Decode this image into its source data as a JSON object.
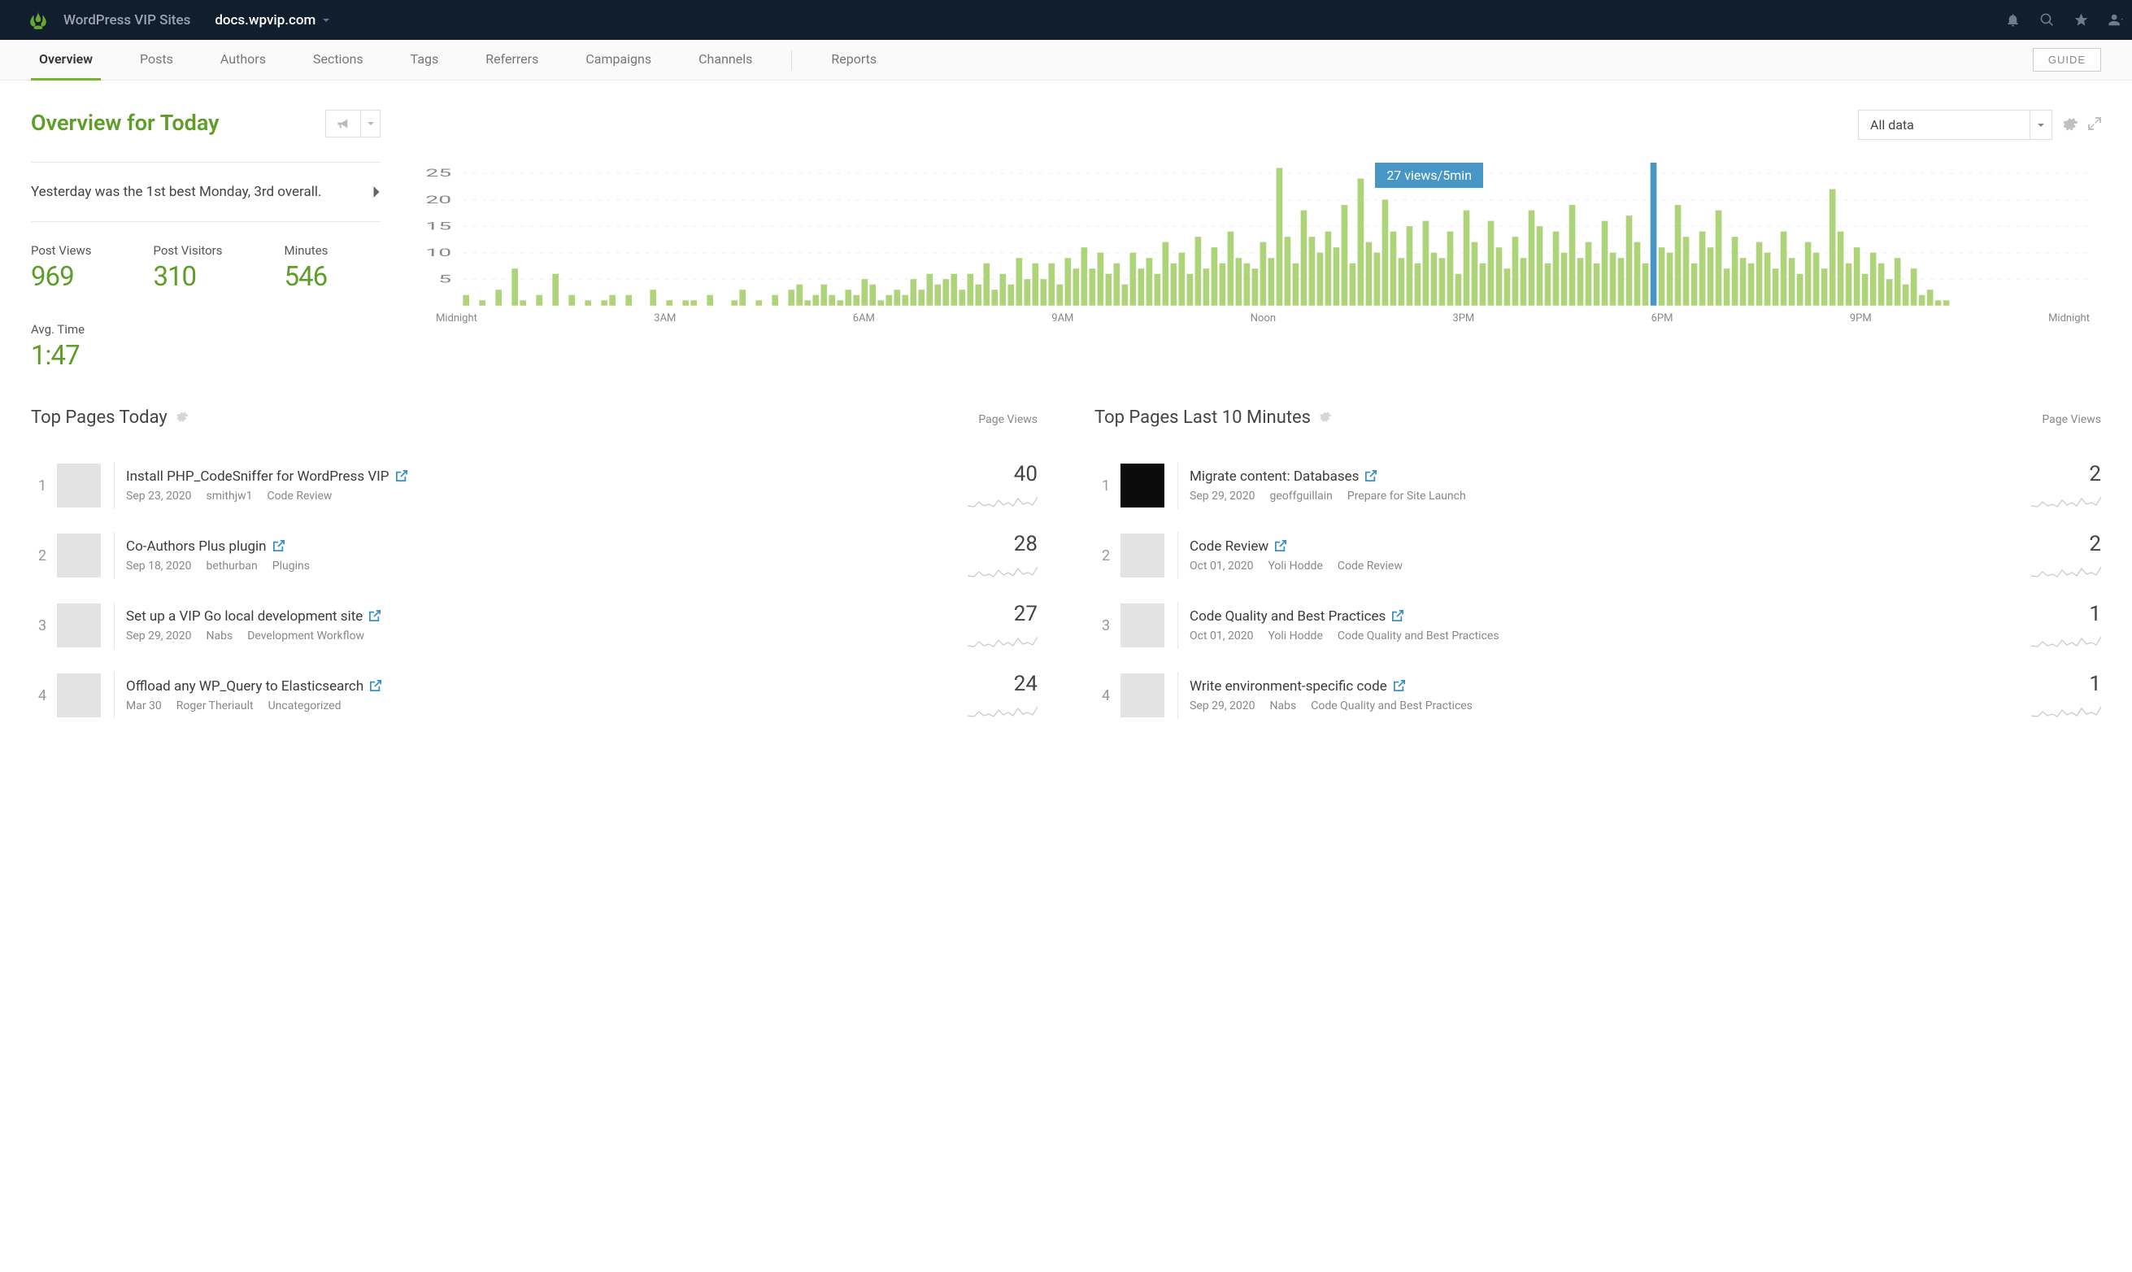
{
  "topbar": {
    "org": "WordPress VIP Sites",
    "site": "docs.wpvip.com"
  },
  "nav": {
    "tabs": [
      "Overview",
      "Posts",
      "Authors",
      "Sections",
      "Tags",
      "Referrers",
      "Campaigns",
      "Channels"
    ],
    "reports": "Reports",
    "guide": "GUIDE"
  },
  "overview": {
    "title": "Overview for Today",
    "insight": "Yesterday was the 1st best Monday, 3rd overall.",
    "metrics": [
      {
        "label": "Post Views",
        "value": "969"
      },
      {
        "label": "Post Visitors",
        "value": "310"
      },
      {
        "label": "Minutes",
        "value": "546"
      },
      {
        "label": "Avg. Time",
        "value": "1:47"
      }
    ]
  },
  "chart_controls": {
    "filter": "All data"
  },
  "chart_tooltip": "27 views/5min",
  "chart_data": {
    "type": "bar",
    "title": "",
    "ylabel": "views/5min",
    "ylim": [
      0,
      27
    ],
    "yticks": [
      5,
      10,
      15,
      20,
      25
    ],
    "xticks": [
      "Midnight",
      "3AM",
      "6AM",
      "9AM",
      "Noon",
      "3PM",
      "6PM",
      "9PM",
      "Midnight"
    ],
    "values": [
      2,
      0,
      1,
      0,
      3,
      0,
      7,
      1,
      0,
      2,
      0,
      6,
      0,
      2,
      0,
      1,
      0,
      1,
      2,
      0,
      2,
      0,
      0,
      3,
      0,
      1,
      0,
      1,
      1,
      0,
      2,
      0,
      0,
      1,
      3,
      0,
      1,
      0,
      2,
      0,
      3,
      4,
      1,
      2,
      4,
      2,
      1,
      3,
      2,
      5,
      4,
      1,
      2,
      3,
      2,
      5,
      3,
      6,
      4,
      5,
      6,
      3,
      6,
      4,
      8,
      3,
      6,
      4,
      9,
      5,
      8,
      5,
      8,
      4,
      9,
      7,
      11,
      7,
      10,
      6,
      8,
      4,
      10,
      7,
      9,
      6,
      12,
      8,
      10,
      6,
      13,
      7,
      11,
      8,
      14,
      9,
      8,
      7,
      12,
      9,
      26,
      13,
      8,
      18,
      13,
      10,
      14,
      11,
      19,
      8,
      24,
      12,
      10,
      20,
      14,
      9,
      15,
      8,
      16,
      10,
      9,
      14,
      6,
      18,
      12,
      8,
      16,
      11,
      7,
      13,
      9,
      18,
      15,
      8,
      14,
      10,
      19,
      9,
      12,
      8,
      16,
      10,
      9,
      17,
      12,
      8,
      27,
      11,
      10,
      19,
      13,
      8,
      14,
      11,
      18,
      7,
      13,
      9,
      8,
      12,
      10,
      7,
      14,
      9,
      6,
      12,
      10,
      7,
      22,
      14,
      8,
      11,
      6,
      10,
      8,
      5,
      9,
      4,
      7,
      2,
      3,
      1,
      1,
      0,
      0,
      0,
      0,
      0,
      0,
      0,
      0,
      0,
      0,
      0,
      0,
      0,
      0,
      0,
      0,
      0
    ],
    "max_index": 146
  },
  "sections": {
    "today": {
      "title": "Top Pages Today",
      "sub": "Page Views",
      "items": [
        {
          "title": "Install PHP_CodeSniffer for WordPress VIP",
          "date": "Sep 23, 2020",
          "author": "smithjw1",
          "cat": "Code Review",
          "count": "40"
        },
        {
          "title": "Co-Authors Plus plugin",
          "date": "Sep 18, 2020",
          "author": "bethurban",
          "cat": "Plugins",
          "count": "28"
        },
        {
          "title": "Set up a VIP Go local development site",
          "date": "Sep 29, 2020",
          "author": "Nabs",
          "cat": "Development Workflow",
          "count": "27"
        },
        {
          "title": "Offload any WP_Query to Elasticsearch",
          "date": "Mar 30",
          "author": "Roger Theriault",
          "cat": "Uncategorized",
          "count": "24"
        }
      ]
    },
    "last10": {
      "title": "Top Pages Last 10 Minutes",
      "sub": "Page Views",
      "items": [
        {
          "title": "Migrate content: Databases",
          "date": "Sep 29, 2020",
          "author": "geoffguillain",
          "cat": "Prepare for Site Launch",
          "count": "2",
          "dark": true
        },
        {
          "title": "Code Review",
          "date": "Oct 01, 2020",
          "author": "Yoli Hodde",
          "cat": "Code Review",
          "count": "2"
        },
        {
          "title": "Code Quality and Best Practices",
          "date": "Oct 01, 2020",
          "author": "Yoli Hodde",
          "cat": "Code Quality and Best Practices",
          "count": "1"
        },
        {
          "title": "Write environment-specific code",
          "date": "Sep 29, 2020",
          "author": "Nabs",
          "cat": "Code Quality and Best Practices",
          "count": "1"
        }
      ]
    }
  }
}
